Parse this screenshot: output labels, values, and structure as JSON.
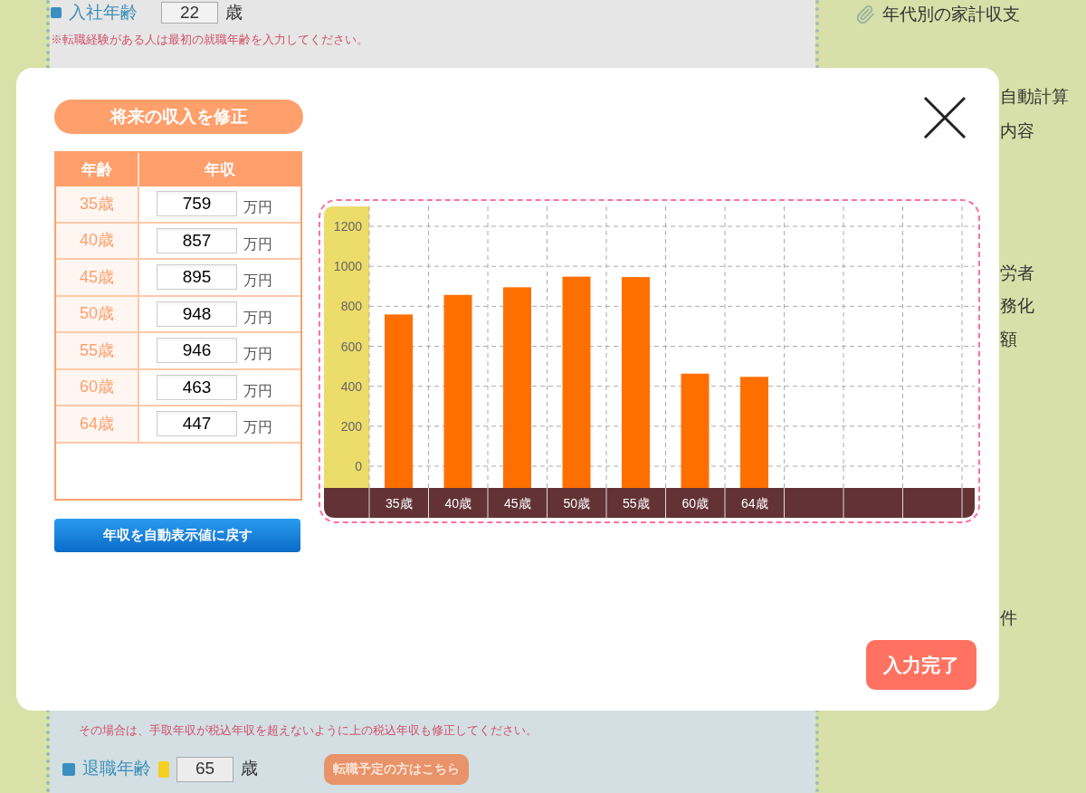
{
  "background": {
    "join_age": {
      "label": "入社年齢",
      "value": "22",
      "unit": "歳"
    },
    "join_note": "※転職経験がある人は最初の就職年齢を入力してください。",
    "income_notes": [
      "その場合は、手取年収が税込年収を超えないように上の税込年収も修正してください。"
    ],
    "retire_age": {
      "label": "退職年齢",
      "value": "65",
      "unit": "歳"
    },
    "job_change_button": "転職予定の方はこちら",
    "sidebar": {
      "link": "年代別の家計収支",
      "items": [
        "自動計算",
        "内容",
        "労者",
        "務化",
        "額",
        "件"
      ]
    }
  },
  "modal": {
    "title": "将来の収入を修正",
    "table": {
      "columns": [
        "年齢",
        "年収"
      ],
      "rows": [
        {
          "age": "35歳",
          "income": "759",
          "unit": "万円"
        },
        {
          "age": "40歳",
          "income": "857",
          "unit": "万円"
        },
        {
          "age": "45歳",
          "income": "895",
          "unit": "万円"
        },
        {
          "age": "50歳",
          "income": "948",
          "unit": "万円"
        },
        {
          "age": "55歳",
          "income": "946",
          "unit": "万円"
        },
        {
          "age": "60歳",
          "income": "463",
          "unit": "万円"
        },
        {
          "age": "64歳",
          "income": "447",
          "unit": "万円"
        }
      ]
    },
    "reset_button": "年収を自動表示値に戻す",
    "chart_data": {
      "type": "bar",
      "categories": [
        "35歳",
        "40歳",
        "45歳",
        "50歳",
        "55歳",
        "60歳",
        "64歳"
      ],
      "series": [
        {
          "color": "#ff6f00",
          "values": [
            759,
            857,
            895,
            948,
            946,
            463,
            447
          ]
        }
      ],
      "grid": true,
      "ylim": [
        0,
        1200
      ],
      "yticks": [
        0,
        200,
        400,
        600,
        800,
        1000,
        1200
      ]
    },
    "done_button": "入力完了"
  }
}
